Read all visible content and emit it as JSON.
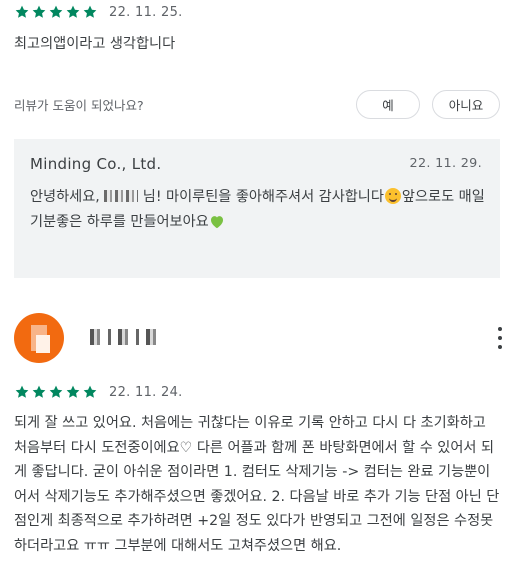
{
  "review_1": {
    "rating": 5,
    "date": "22. 11. 25.",
    "text": "최고의앱이라고 생각합니다"
  },
  "helpful": {
    "question": "리뷰가 도움이 되었나요?",
    "yes_label": "예",
    "no_label": "아니요"
  },
  "developer_reply": {
    "developer_name": "Minding Co., Ltd.",
    "date": "22. 11. 29.",
    "text_before_name": "안녕하세요, ",
    "text_after_name": " 님! 마이루틴을 좋아해주셔서 감사합니다",
    "text_after_smile": "앞으로도 매일 기분좋은 하루를 만들어보아요",
    "smile_emoji": "smiling-face-emoji",
    "heart_emoji": "green-heart-emoji"
  },
  "review_2": {
    "reviewer_name": "",
    "rating": 5,
    "date": "22. 11. 24.",
    "text": "되게 잘 쓰고 있어요. 처음에는 귀찮다는 이유로 기록 안하고 다시 다 초기화하고 처음부터 다시 도전중이에요♡ 다른 어플과 함께 폰 바탕화면에서 할 수 있어서 되게 좋답니다. 굳이 아쉬운 점이라면 1. 컴터도 삭제기능 -> 컴터는 완료 기능뿐이어서 삭제기능도 추가해주셨으면 좋겠어요. 2. 다음날 바로 추가 기능 단점 아닌 단점인게 최종적으로 추가하려면 +2일 정도 있다가 반영되고 그전에 일정은 수정못하더라고요 ㅠㅠ 그부분에 대해서도 고쳐주셨으면 해요."
  },
  "colors": {
    "star": "#01875f",
    "avatar": "#f26a10",
    "reply_background": "#f1f3f4",
    "heart": "#7ac142"
  },
  "icons": {
    "star": "star-icon",
    "more": "more-vert-icon"
  }
}
